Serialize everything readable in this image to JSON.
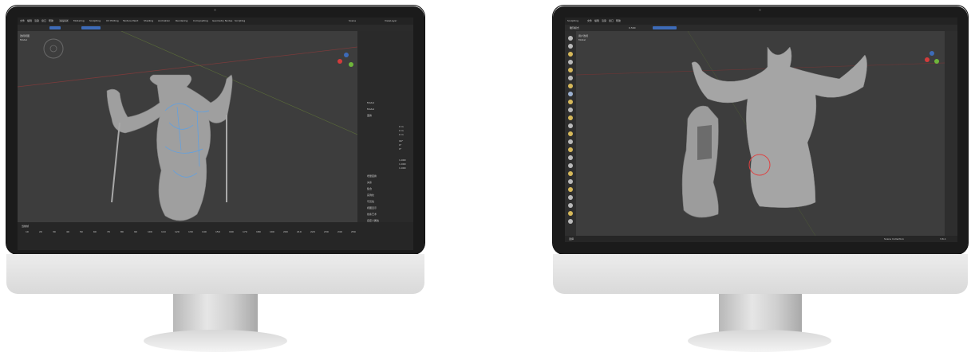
{
  "left_app": {
    "menu": [
      "文件",
      "编辑",
      "渲染",
      "窗口",
      "帮助",
      "Layout",
      "Modeling",
      "Sculpting",
      "UV Editing",
      "Texture Paint",
      "Shading",
      "Animation",
      "Rendering",
      "Compositing",
      "Geometry Nodes",
      "Scripting"
    ],
    "scene_label": "Scene",
    "view_layer": "ViewLayer",
    "viewport_label": "透视视图",
    "object_name": "Model",
    "timeline_label": "当前帧",
    "timeline_frames": [
      "10",
      "20",
      "30",
      "40",
      "50",
      "60",
      "70",
      "80",
      "90",
      "100",
      "110",
      "120",
      "130",
      "140",
      "150",
      "160",
      "170",
      "180",
      "190",
      "200",
      "210",
      "220",
      "230",
      "240",
      "250"
    ],
    "props": {
      "object": "Model",
      "mesh": "Model",
      "fields": [
        "0 m",
        "0 m",
        "0 m",
        "90°",
        "0°",
        "0°",
        "1.000",
        "1.000",
        "1.000"
      ],
      "sections": [
        "变换",
        "增量变换",
        "关系",
        "集合",
        "实例化",
        "可见性",
        "视图显示",
        "线条艺术",
        "自定义属性"
      ]
    }
  },
  "right_app": {
    "menu": [
      "Sculpting",
      "文件",
      "编辑",
      "渲染",
      "窗口",
      "帮助"
    ],
    "mode": "雕刻模式",
    "object_name": "Model",
    "viewport_label": "用户透视",
    "brush_strength": "0.500",
    "status_text": "选择",
    "status_right": "Scene Collection",
    "version": "3.6.1"
  },
  "colors": {
    "bezel": "#1b1b1b",
    "viewport": "#3d3d3d",
    "accent_blue": "#3d6bb8",
    "axis_red": "#d33b3b",
    "axis_green": "#6fb53b",
    "brush_circle": "#e04040",
    "wire": "#5aa0e8"
  }
}
